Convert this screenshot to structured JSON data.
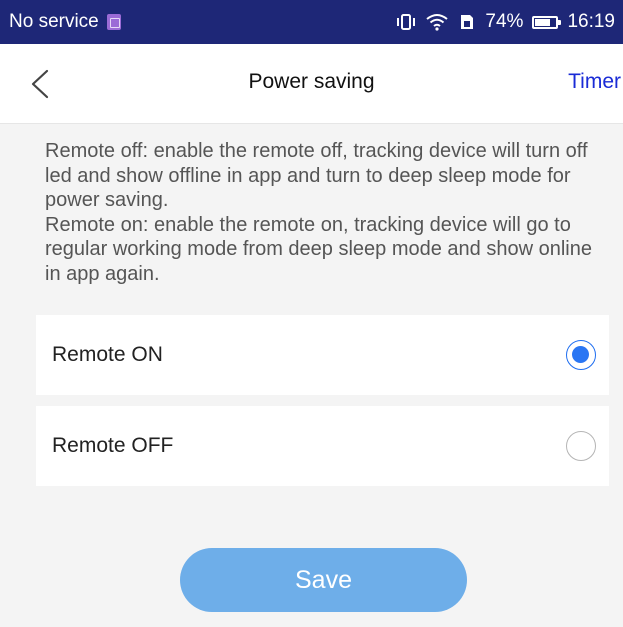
{
  "status_bar": {
    "carrier": "No service",
    "battery_percent": "74%",
    "time": "16:19"
  },
  "nav": {
    "title": "Power saving",
    "timer_label": "Timer"
  },
  "description": {
    "remote_off_text": "Remote off: enable the remote off, tracking device will turn off led and show offline in app and turn to deep sleep mode for power saving.",
    "remote_on_text": "Remote on: enable the remote on, tracking device will go to regular working mode from deep sleep mode and show online in app again."
  },
  "options": [
    {
      "label": "Remote ON",
      "selected": true
    },
    {
      "label": "Remote OFF",
      "selected": false
    }
  ],
  "save_label": "Save",
  "colors": {
    "status_bar_bg": "#1e2777",
    "accent_link": "#1a2bd6",
    "radio_selected": "#2a76f3",
    "save_button_bg": "#6eaee9"
  }
}
